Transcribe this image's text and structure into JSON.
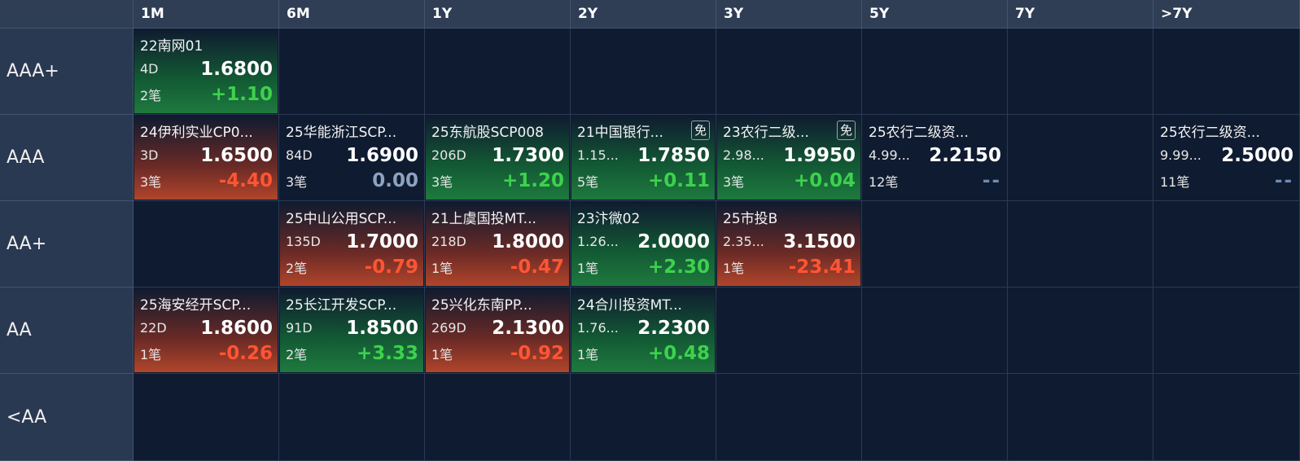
{
  "columns": [
    "1M",
    "6M",
    "1Y",
    "2Y",
    "3Y",
    "5Y",
    "7Y",
    ">7Y"
  ],
  "rows": [
    "AAA+",
    "AAA",
    "AA+",
    "AA",
    "<AA"
  ],
  "colors": {
    "up": "#3dd24d",
    "down": "#ff5533",
    "zero": "#8da2bf",
    "background": "#0f1b30",
    "header": "#2f3d55"
  },
  "grid": [
    [
      {
        "name": "22南网01",
        "term": "4D",
        "price": "1.6800",
        "trades": "2笔",
        "change": "+1.10",
        "dir": "up",
        "badge": ""
      },
      null,
      null,
      null,
      null,
      null,
      null,
      null
    ],
    [
      {
        "name": "24伊利实业CP0...",
        "term": "3D",
        "price": "1.6500",
        "trades": "3笔",
        "change": "-4.40",
        "dir": "down",
        "badge": ""
      },
      {
        "name": "25华能浙江SCP...",
        "term": "84D",
        "price": "1.6900",
        "trades": "3笔",
        "change": "0.00",
        "dir": "zero",
        "badge": ""
      },
      {
        "name": "25东航股SCP008",
        "term": "206D",
        "price": "1.7300",
        "trades": "3笔",
        "change": "+1.20",
        "dir": "up",
        "badge": ""
      },
      {
        "name": "21中国银行...",
        "term": "1.15...",
        "price": "1.7850",
        "trades": "5笔",
        "change": "+0.11",
        "dir": "up",
        "badge": "免"
      },
      {
        "name": "23农行二级...",
        "term": "2.98...",
        "price": "1.9950",
        "trades": "3笔",
        "change": "+0.04",
        "dir": "up",
        "badge": "免"
      },
      {
        "name": "25农行二级资...",
        "term": "4.99...",
        "price": "2.2150",
        "trades": "12笔",
        "change": "--",
        "dir": "none",
        "badge": ""
      },
      null,
      {
        "name": "25农行二级资...",
        "term": "9.99...",
        "price": "2.5000",
        "trades": "11笔",
        "change": "--",
        "dir": "none",
        "badge": ""
      }
    ],
    [
      null,
      {
        "name": "25中山公用SCP...",
        "term": "135D",
        "price": "1.7000",
        "trades": "2笔",
        "change": "-0.79",
        "dir": "down",
        "badge": ""
      },
      {
        "name": "21上虞国投MT...",
        "term": "218D",
        "price": "1.8000",
        "trades": "1笔",
        "change": "-0.47",
        "dir": "down",
        "badge": ""
      },
      {
        "name": "23汴微02",
        "term": "1.26...",
        "price": "2.0000",
        "trades": "1笔",
        "change": "+2.30",
        "dir": "up",
        "badge": ""
      },
      {
        "name": "25市投B",
        "term": "2.35...",
        "price": "3.1500",
        "trades": "1笔",
        "change": "-23.41",
        "dir": "down",
        "badge": ""
      },
      null,
      null,
      null
    ],
    [
      {
        "name": "25海安经开SCP...",
        "term": "22D",
        "price": "1.8600",
        "trades": "1笔",
        "change": "-0.26",
        "dir": "down",
        "badge": ""
      },
      {
        "name": "25长江开发SCP...",
        "term": "91D",
        "price": "1.8500",
        "trades": "2笔",
        "change": "+3.33",
        "dir": "up",
        "badge": ""
      },
      {
        "name": "25兴化东南PP...",
        "term": "269D",
        "price": "2.1300",
        "trades": "1笔",
        "change": "-0.92",
        "dir": "down",
        "badge": ""
      },
      {
        "name": "24合川投资MT...",
        "term": "1.76...",
        "price": "2.2300",
        "trades": "1笔",
        "change": "+0.48",
        "dir": "up",
        "badge": ""
      },
      null,
      null,
      null,
      null
    ],
    [
      null,
      null,
      null,
      null,
      null,
      null,
      null,
      null
    ]
  ]
}
